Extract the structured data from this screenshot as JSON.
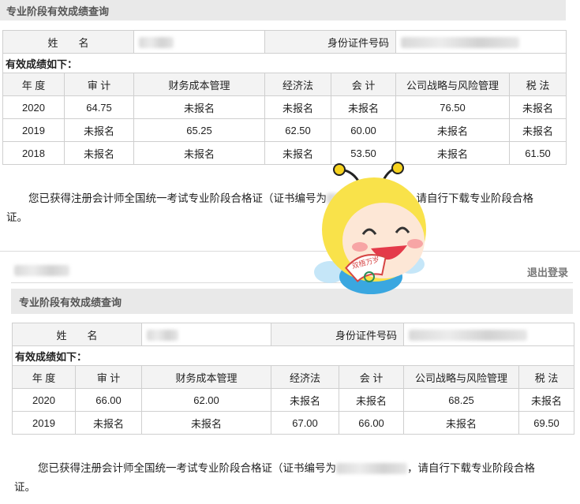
{
  "top": {
    "panel_title": "专业阶段有效成绩查询",
    "name_label": "姓　　名",
    "id_label": "身份证件号码",
    "section_title": "有效成绩如下：",
    "headers": [
      "年 度",
      "审 计",
      "财务成本管理",
      "经济法",
      "会 计",
      "公司战略与风险管理",
      "税 法"
    ],
    "rows": [
      [
        "2020",
        "64.75",
        "未报名",
        "未报名",
        "未报名",
        "76.50",
        "未报名"
      ],
      [
        "2019",
        "未报名",
        "65.25",
        "62.50",
        "60.00",
        "未报名",
        "未报名"
      ],
      [
        "2018",
        "未报名",
        "未报名",
        "未报名",
        "53.50",
        "未报名",
        "61.50"
      ]
    ],
    "notice_a": "您已获得注册会计师全国统一考试专业阶段合格证（证书编号为",
    "notice_b": "，请自行下载专业阶段合格",
    "notice_c": "证。"
  },
  "bottom": {
    "logout": "退出登录",
    "panel_title": "专业阶段有效成绩查询",
    "name_label": "姓　　名",
    "id_label": "身份证件号码",
    "section_title": "有效成绩如下：",
    "headers": [
      "年 度",
      "审 计",
      "财务成本管理",
      "经济法",
      "会 计",
      "公司战略与风险管理",
      "税 法"
    ],
    "rows": [
      [
        "2020",
        "66.00",
        "62.00",
        "未报名",
        "未报名",
        "68.25",
        "未报名"
      ],
      [
        "2019",
        "未报名",
        "未报名",
        "67.00",
        "66.00",
        "未报名",
        "69.50"
      ]
    ],
    "notice_a": "您已获得注册会计师全国统一考试专业阶段合格证（证书编号为",
    "notice_b": "，请自行下载专业阶段合格",
    "notice_c": "证。"
  },
  "mascot": {
    "badge_text": "双梧万岁",
    "icon": "bee-mascot-icon"
  },
  "colors": {
    "panel_bg": "#e9e9e9",
    "border": "#cfcfcf",
    "label_bg": "#f3f3f3"
  }
}
